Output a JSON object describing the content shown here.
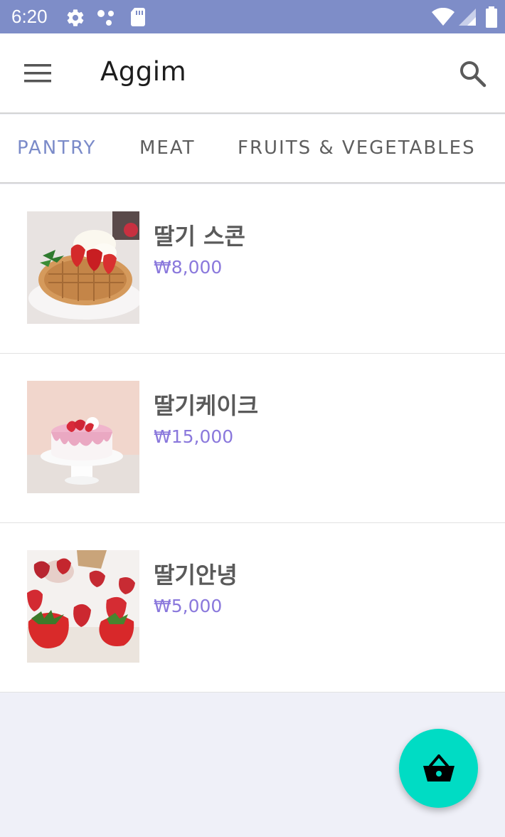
{
  "status_bar": {
    "time": "6:20",
    "left_icons": [
      "gear-icon",
      "dots-icon",
      "sd-card-icon"
    ],
    "right_icons": [
      "wifi-icon",
      "signal-icon",
      "battery-icon"
    ],
    "background": "#7e8dc8"
  },
  "app_bar": {
    "title": "Aggim",
    "menu_icon": "menu-icon",
    "search_icon": "search-icon"
  },
  "tabs": [
    {
      "label": "PANTRY",
      "active": true
    },
    {
      "label": "MEAT",
      "active": false
    },
    {
      "label": "FRUITS & VEGETABLES",
      "active": false
    }
  ],
  "products": [
    {
      "name": "딸기 스콘",
      "price": "₩8,000",
      "image": "strawberry-waffle-image"
    },
    {
      "name": "딸기케이크",
      "price": "₩15,000",
      "image": "strawberry-cake-image"
    },
    {
      "name": "딸기안녕",
      "price": "₩5,000",
      "image": "strawberries-image"
    }
  ],
  "fab": {
    "icon": "shopping-basket-icon",
    "color": "#00dcc4"
  },
  "colors": {
    "accent": "#7b8bc9",
    "price": "#8a78dc",
    "page_background": "#eff0f8"
  }
}
